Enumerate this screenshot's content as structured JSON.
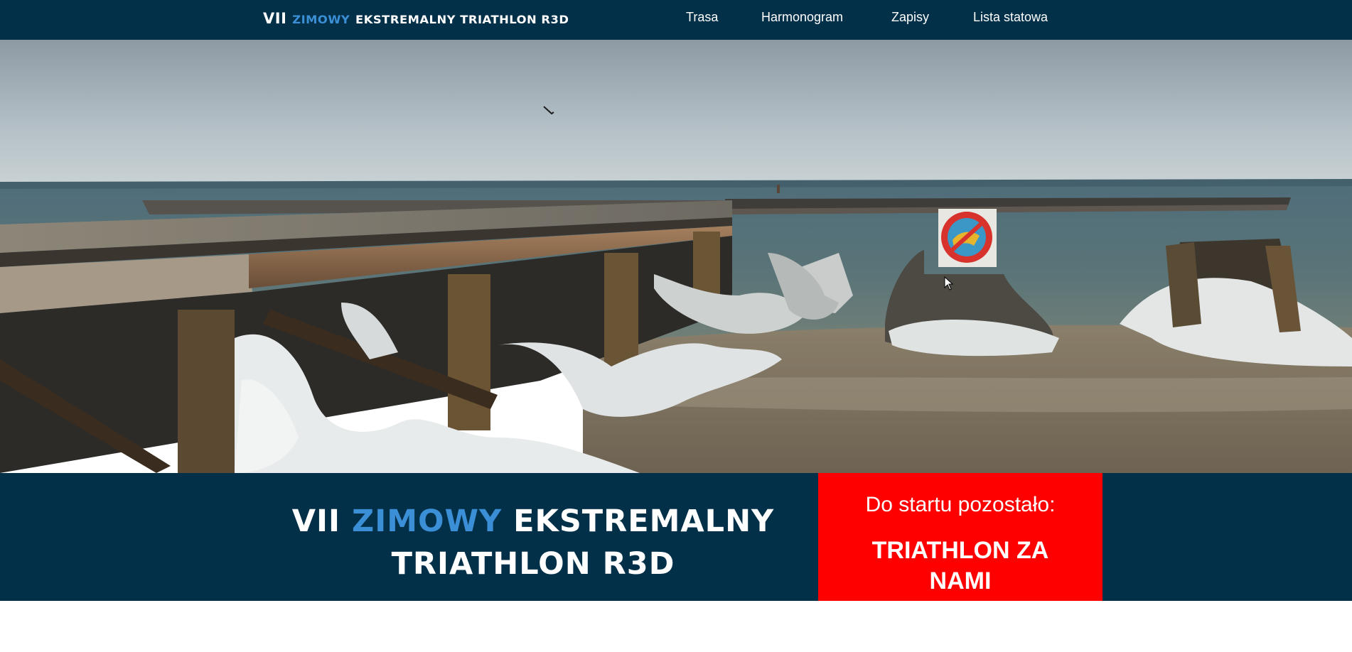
{
  "navbar": {
    "brand": {
      "prefix": "VII",
      "accent": "ZIMOWY",
      "rest": "EKSTREMALNY TRIATHLON R3D"
    },
    "links": [
      {
        "label": "Trasa"
      },
      {
        "label": "Harmonogram"
      },
      {
        "label": "Zapisy"
      },
      {
        "label": "Lista statowa"
      }
    ]
  },
  "hero": {
    "title_line1_prefix": "VII",
    "title_line1_accent": "ZIMOWY",
    "title_line1_rest": "EKSTREMALNY",
    "title_line2": "TRIATHLON R3D"
  },
  "countdown": {
    "label": "Do startu pozostało:",
    "status": "TRIATHLON ZA NAMI"
  },
  "colors": {
    "navy": "#033049",
    "accent_blue": "#3b8fd6",
    "countdown_red": "#ff0000"
  }
}
